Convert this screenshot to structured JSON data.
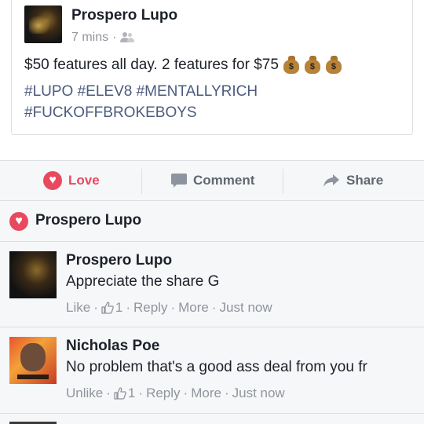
{
  "post": {
    "author": "Prospero Lupo",
    "time": "7 mins",
    "meta_separator": "·",
    "privacy_icon": "friends-icon",
    "text": "$50 features all day. 2 features for $75",
    "emoji": [
      "money-bag",
      "money-bag",
      "money-bag"
    ],
    "hashtags": "#LUPO #ELEV8 #MENTALLYRICH #FUCKOFFBROKEBOYS"
  },
  "actions": {
    "love": "Love",
    "comment": "Comment",
    "share": "Share"
  },
  "reactions": {
    "icon": "love-heart-icon",
    "name": "Prospero Lupo"
  },
  "comments": [
    {
      "author": "Prospero Lupo",
      "text": "Appreciate the share G",
      "like_label": "Like",
      "like_count": "1",
      "reply": "Reply",
      "more": "More",
      "time": "Just now"
    },
    {
      "author": "Nicholas Poe",
      "text": "No problem that's a good ass deal from you fr",
      "like_label": "Unlike",
      "like_count": "1",
      "reply": "Reply",
      "more": "More",
      "time": "Just now"
    }
  ],
  "colors": {
    "love_red": "#e9495f",
    "hashtag_blue": "#4b5b7e",
    "meta_gray": "#90949c",
    "panel_bg": "#f6f7f9"
  }
}
